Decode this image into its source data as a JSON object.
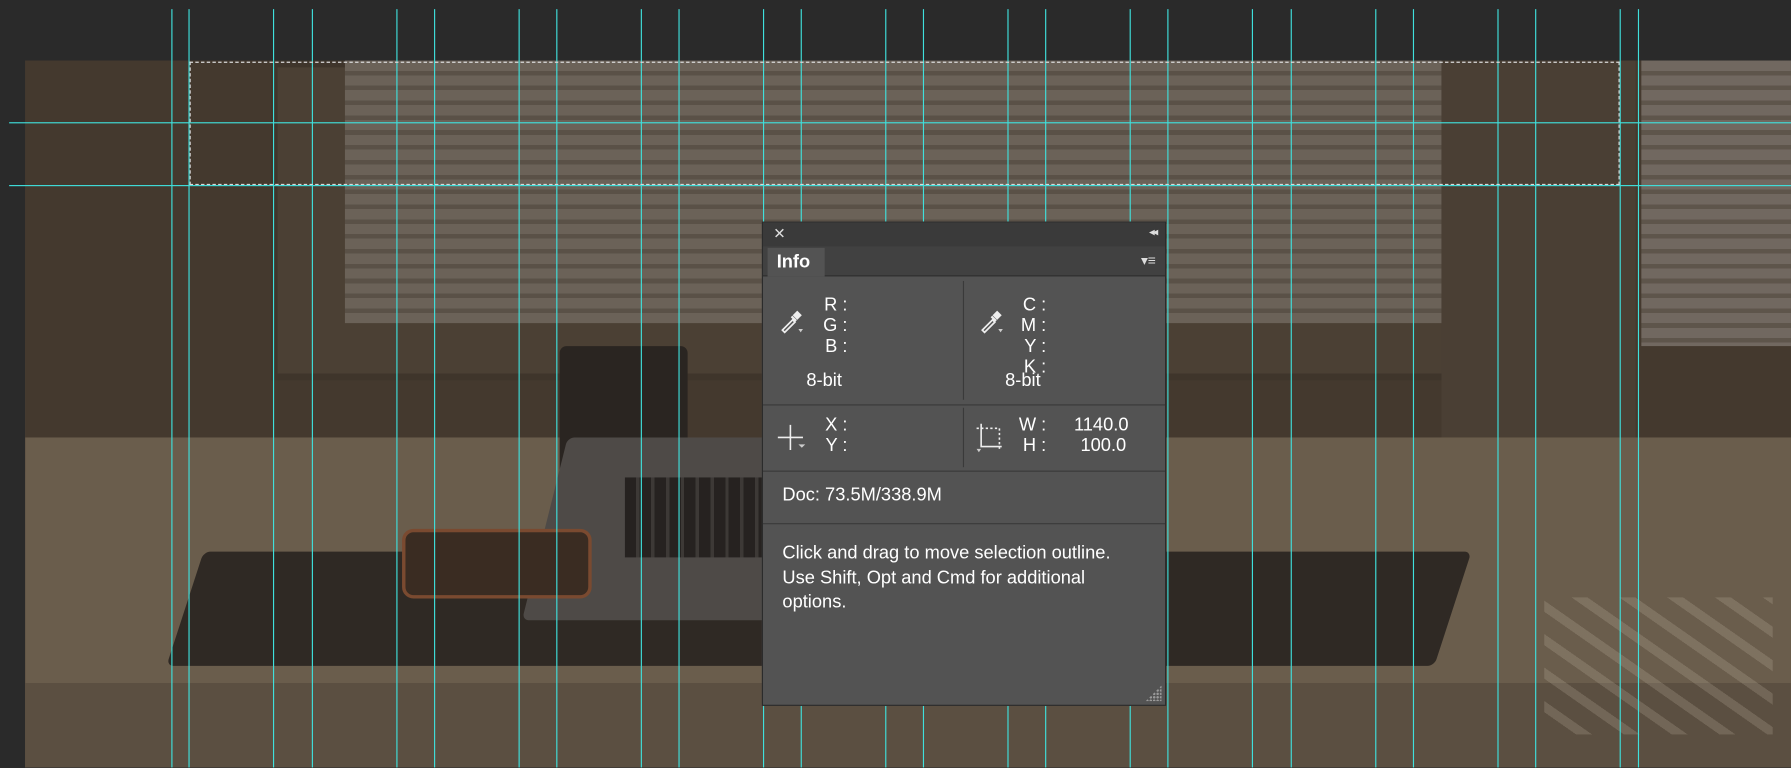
{
  "info_panel": {
    "tab_label": "Info",
    "close_glyph": "✕",
    "collapse_glyph": "◂◂",
    "menu_glyph": "▾≡",
    "rgb": {
      "r_label": "R :",
      "g_label": "G :",
      "b_label": "B :",
      "bit_depth": "8-bit"
    },
    "cmyk": {
      "c_label": "C :",
      "m_label": "M :",
      "y_label": "Y :",
      "k_label": "K :",
      "bit_depth": "8-bit"
    },
    "position": {
      "x_label": "X :",
      "y_label": "Y :"
    },
    "size": {
      "w_label": "W :",
      "h_label": "H :",
      "w_value": "1140.0",
      "h_value": "100.0"
    },
    "doc": "Doc: 73.5M/338.9M",
    "hint": "Click and drag to move selection outline.  Use Shift, Opt and Cmd for additional options."
  },
  "colors": {
    "guide": "#3fe0dc",
    "panel_bg": "#535353",
    "workspace": "#2a2a2a"
  },
  "icons": [
    "close-icon",
    "collapse-icon",
    "panel-menu-icon",
    "eyedropper-icon",
    "crosshair-icon",
    "selection-size-icon",
    "resize-grip-icon"
  ]
}
